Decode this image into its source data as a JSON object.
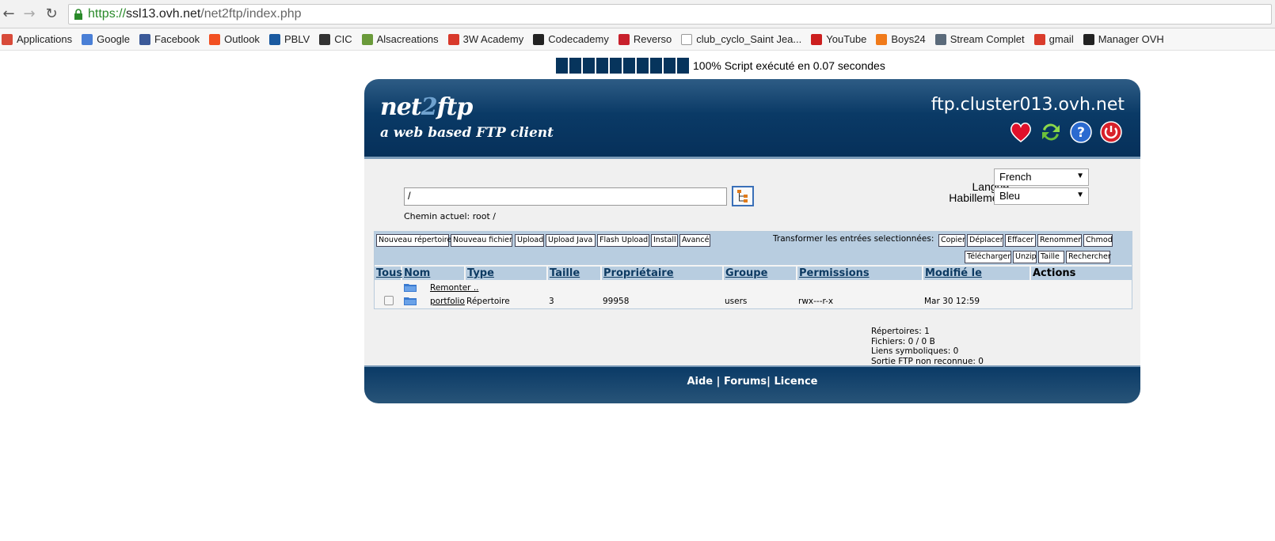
{
  "browser": {
    "url_scheme": "https://",
    "url_host": "ssl13.ovh.net",
    "url_path": "/net2ftp/index.php",
    "bookmarks": [
      {
        "label": "Applications",
        "icon": "apps-grid-icon",
        "color": "#d84b3a"
      },
      {
        "label": "Google",
        "icon": "google-icon",
        "color": "#4a7fd6"
      },
      {
        "label": "Facebook",
        "icon": "facebook-icon",
        "color": "#3b5998"
      },
      {
        "label": "Outlook",
        "icon": "outlook-icon",
        "color": "#f25022"
      },
      {
        "label": "PBLV",
        "icon": "pblv-icon",
        "color": "#1a5aa0"
      },
      {
        "label": "CIC",
        "icon": "cic-icon",
        "color": "#333333"
      },
      {
        "label": "Alsacreations",
        "icon": "alsacreations-icon",
        "color": "#6a9a3a"
      },
      {
        "label": "3W Academy",
        "icon": "3w-academy-icon",
        "color": "#d8392b"
      },
      {
        "label": "Codecademy",
        "icon": "codecademy-icon",
        "color": "#222222"
      },
      {
        "label": "Reverso",
        "icon": "reverso-icon",
        "color": "#c8202c"
      },
      {
        "label": "club_cyclo_Saint Jea...",
        "icon": "page-icon",
        "color": "#ffffff"
      },
      {
        "label": "YouTube",
        "icon": "youtube-icon",
        "color": "#cc1f1f"
      },
      {
        "label": "Boys24",
        "icon": "boys24-icon",
        "color": "#f07a1a"
      },
      {
        "label": "Stream Complet",
        "icon": "film-icon",
        "color": "#5a6a7a"
      },
      {
        "label": "gmail",
        "icon": "gmail-icon",
        "color": "#d93b2b"
      },
      {
        "label": "Manager OVH",
        "icon": "ovh-icon",
        "color": "#222222"
      }
    ]
  },
  "progress": {
    "percent": 100,
    "boxes": 10,
    "text": "100% Script exécuté en 0.07 secondes"
  },
  "header": {
    "logo_pre": "net",
    "logo_two": "2",
    "logo_post": "ftp",
    "tagline": "a web based FTP client",
    "server": "ftp.cluster013.ovh.net",
    "icons": [
      "heart-icon",
      "refresh-icon",
      "help-icon",
      "power-icon"
    ]
  },
  "directory": {
    "value": "/",
    "current_path": "Chemin actuel: root /"
  },
  "settings": {
    "language_label": "Langue :",
    "language_value": "French",
    "skin_label": "Habillement :",
    "skin_value": "Bleu"
  },
  "toolbar": {
    "left_buttons": [
      "Nouveau répertoire",
      "Nouveau fichier",
      "Upload",
      "Upload Java",
      "Flash Upload",
      "Install",
      "Avancé"
    ],
    "transform_label": "Transformer les entrées selectionnées:",
    "right_row1": [
      "Copier",
      "Déplacer",
      "Effacer",
      "Renommer",
      "Chmod"
    ],
    "right_row2": [
      "Télécharger",
      "Unzip",
      "Taille",
      "Rechercher"
    ]
  },
  "table": {
    "columns": [
      "Tous",
      "Nom",
      "Type",
      "Taille",
      "Propriétaire",
      "Groupe",
      "Permissions",
      "Modifié le",
      "Actions"
    ],
    "up_label": "Remonter ..",
    "rows": [
      {
        "name": "portfolio",
        "type": "Répertoire",
        "size": "3",
        "owner": "99958",
        "group": "users",
        "permissions": "rwx---r-x",
        "modified": "Mar 30 12:59"
      }
    ]
  },
  "stats": {
    "dirs": "Répertoires: 1",
    "files": "Fichiers: 0 / 0 B",
    "symlinks": "Liens symboliques: 0",
    "unrecognized": "Sortie FTP non reconnue: 0"
  },
  "footer": {
    "help": "Aide",
    "sep1": " | ",
    "forums": "Forums",
    "sep2": "| ",
    "license": "Licence"
  }
}
